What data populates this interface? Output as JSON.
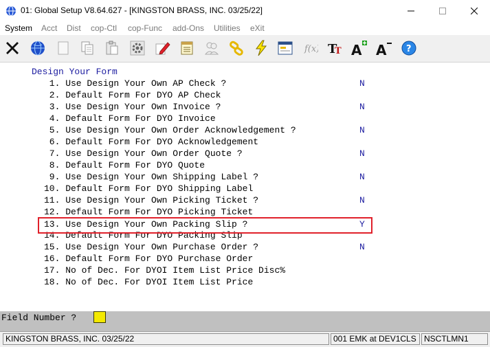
{
  "window": {
    "title": "01: Global Setup V8.64.627 - [KINGSTON BRASS, INC. 03/25/22]"
  },
  "menu": {
    "items": [
      {
        "label": "System",
        "enabled": true
      },
      {
        "label": "Acct",
        "enabled": false
      },
      {
        "label": "Dist",
        "enabled": false
      },
      {
        "label": "cop-Ctl",
        "enabled": false
      },
      {
        "label": "cop-Func",
        "enabled": false
      },
      {
        "label": "add-Ons",
        "enabled": false
      },
      {
        "label": "Utilities",
        "enabled": false
      },
      {
        "label": "eXit",
        "enabled": false
      }
    ]
  },
  "toolbar": {
    "icons": [
      "close-x-icon",
      "globe-icon",
      "blank-page-icon",
      "copy-icon",
      "paste-icon",
      "settings-gear-icon",
      "edit-pencil-icon",
      "notepad-icon",
      "users-icon",
      "chain-link-icon",
      "lightning-icon",
      "window-form-icon",
      "function-icon",
      "font-tt-icon",
      "font-increase-icon",
      "font-decrease-icon",
      "help-icon"
    ]
  },
  "form": {
    "heading": "Design Your Form",
    "lines": [
      {
        "text": " 1. Use Design Your Own AP Check ?",
        "value": "N"
      },
      {
        "text": " 2. Default Form For DYO AP Check",
        "value": ""
      },
      {
        "text": " 3. Use Design Your Own Invoice ?",
        "value": "N"
      },
      {
        "text": " 4. Default Form For DYO Invoice",
        "value": ""
      },
      {
        "text": " 5. Use Design Your Own Order Acknowledgement ?",
        "value": "N"
      },
      {
        "text": " 6. Default Form For DYO Acknowledgement",
        "value": ""
      },
      {
        "text": " 7. Use Design Your Own Order Quote ?",
        "value": "N"
      },
      {
        "text": " 8. Default Form For DYO Quote",
        "value": ""
      },
      {
        "text": " 9. Use Design Your Own Shipping Label ?",
        "value": "N"
      },
      {
        "text": "10. Default Form For DYO Shipping Label",
        "value": ""
      },
      {
        "text": "11. Use Design Your Own Picking Ticket ?",
        "value": "N"
      },
      {
        "text": "12. Default Form For DYO Picking Ticket",
        "value": ""
      },
      {
        "text": "13. Use Design Your Own Packing Slip ?",
        "value": "Y"
      },
      {
        "text": "14. Default Form For DYO Packing Slip",
        "value": ""
      },
      {
        "text": "15. Use Design Your Own Purchase Order ?",
        "value": "N"
      },
      {
        "text": "16. Default Form For DYO Purchase Order",
        "value": ""
      },
      {
        "text": "17. No of Dec. For DYOI Item List Price Disc%",
        "value": ""
      },
      {
        "text": "18. No of Dec. For DYOI Item List Price",
        "value": ""
      }
    ]
  },
  "prompt": {
    "label": "Field Number ?",
    "value": ""
  },
  "status": {
    "company": "KINGSTON BRASS, INC. 03/25/22",
    "session": "001 EMK at DEV1CLS",
    "program": "NSCTLMN1"
  },
  "colors": {
    "highlight_border": "#e0202a",
    "value_text": "#1c1ca0",
    "prompt_input_bg": "#f4e900"
  }
}
